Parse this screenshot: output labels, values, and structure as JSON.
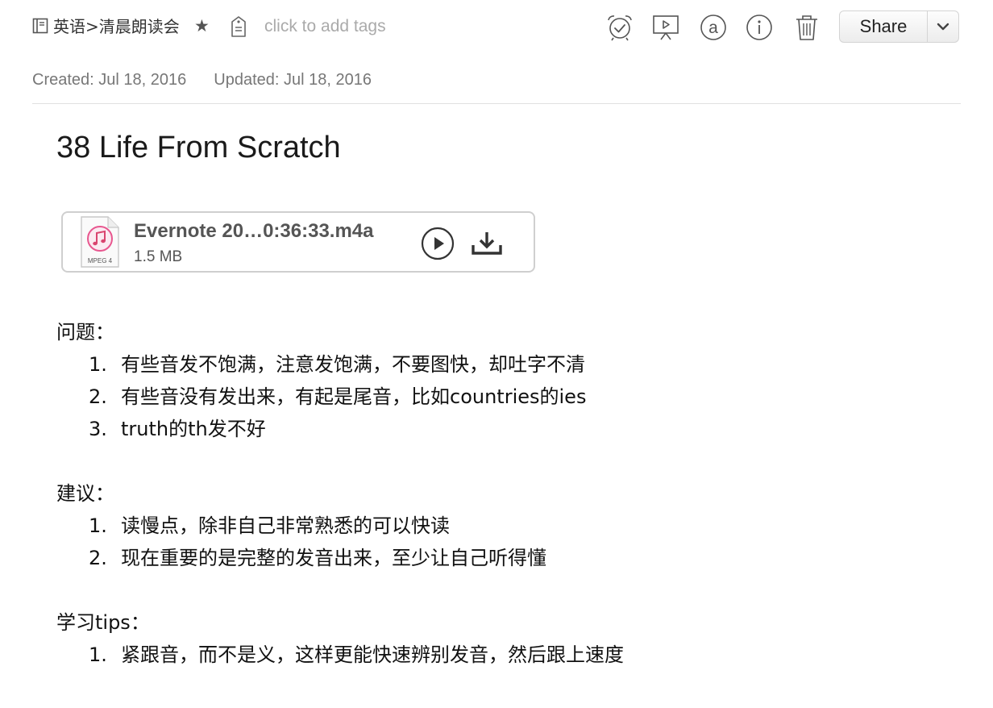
{
  "header": {
    "notebook": "英语>清晨朗读会",
    "star_glyph": "★",
    "tags_placeholder": "click to add tags",
    "toolbar_icons": [
      "alarm-clock-icon",
      "presentation-icon",
      "at-sign-icon",
      "info-icon",
      "trash-icon"
    ],
    "share_label": "Share"
  },
  "meta": {
    "created": "Created: Jul 18, 2016",
    "updated": "Updated: Jul 18, 2016"
  },
  "note": {
    "title": "38 Life From Scratch",
    "attachment": {
      "file_name": "Evernote 20…0:36:33.m4a",
      "file_size": "1.5 MB",
      "file_type_label": "MPEG 4"
    },
    "sections": [
      {
        "heading": "问题：",
        "items": [
          "有些音发不饱满，注意发饱满，不要图快，却吐字不清",
          "有些音没有发出来，有起是尾音，比如countries的ies",
          "truth的th发不好"
        ]
      },
      {
        "heading": "建议：",
        "items": [
          "读慢点，除非自己非常熟悉的可以快读",
          "现在重要的是完整的发音出来，至少让自己听得懂"
        ]
      },
      {
        "heading": "学习tips：",
        "items": [
          "紧跟音，而不是义，这样更能快速辨别发音，然后跟上速度"
        ]
      }
    ],
    "list_numbers": [
      "1.",
      "2.",
      "3."
    ]
  },
  "colors": {
    "text": "#1a1a1a",
    "meta": "#777777",
    "placeholder": "#aaaaaa",
    "icon": "#555555",
    "border": "#cfcfcf"
  }
}
